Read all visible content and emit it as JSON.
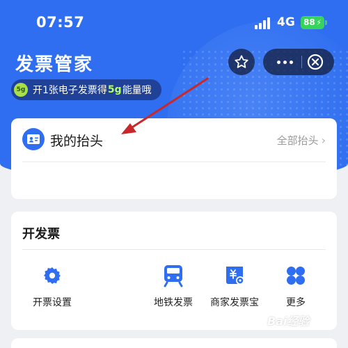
{
  "status": {
    "time": "07:57",
    "network": "4G",
    "battery": "88"
  },
  "header": {
    "title": "发票管家"
  },
  "promo": {
    "coin": "5g",
    "prefix": "开1张电子发票得",
    "highlight": "5g",
    "suffix": "能量哦"
  },
  "my_header": {
    "title": "我的抬头",
    "all_link": "全部抬头"
  },
  "invoice": {
    "title": "开发票",
    "actions": [
      {
        "label": "开票设置",
        "icon": "gear-icon"
      },
      {
        "label": "地铁发票",
        "icon": "subway-icon"
      },
      {
        "label": "商家发票宝",
        "icon": "merchant-invoice-icon"
      },
      {
        "label": "更多",
        "icon": "more-grid-icon"
      }
    ]
  },
  "watermark": {
    "text": "Bai经验"
  },
  "colors": {
    "brand": "#2f6ef0",
    "energy": "#b6ff5c",
    "battery": "#37d35c",
    "arrow": "#c8282a"
  }
}
